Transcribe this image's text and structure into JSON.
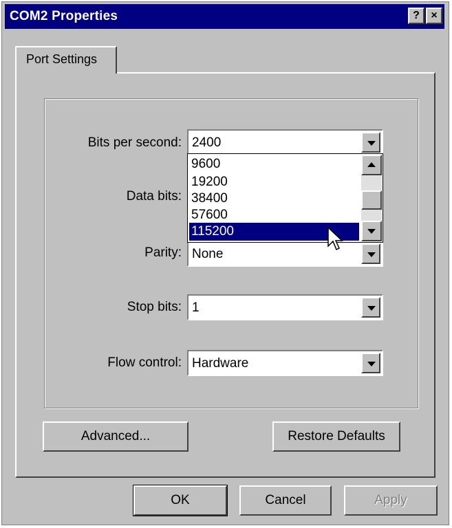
{
  "window": {
    "title": "COM2 Properties",
    "help_btn": "?",
    "close_btn": "×"
  },
  "tabs": [
    {
      "label": "Port Settings"
    }
  ],
  "fields": {
    "bits_per_second": {
      "label": "Bits per second:",
      "value": "2400"
    },
    "data_bits": {
      "label": "Data bits:"
    },
    "parity": {
      "label": "Parity:",
      "value": "None"
    },
    "stop_bits": {
      "label": "Stop bits:",
      "value": "1"
    },
    "flow_control": {
      "label": "Flow control:",
      "value": "Hardware"
    }
  },
  "dropdown": {
    "options": [
      "9600",
      "19200",
      "38400",
      "57600",
      "115200"
    ],
    "highlighted": "115200"
  },
  "buttons": {
    "advanced": "Advanced...",
    "restore": "Restore Defaults",
    "ok": "OK",
    "cancel": "Cancel",
    "apply": "Apply"
  },
  "icons": {
    "cursor": "mouse-pointer-icon"
  }
}
